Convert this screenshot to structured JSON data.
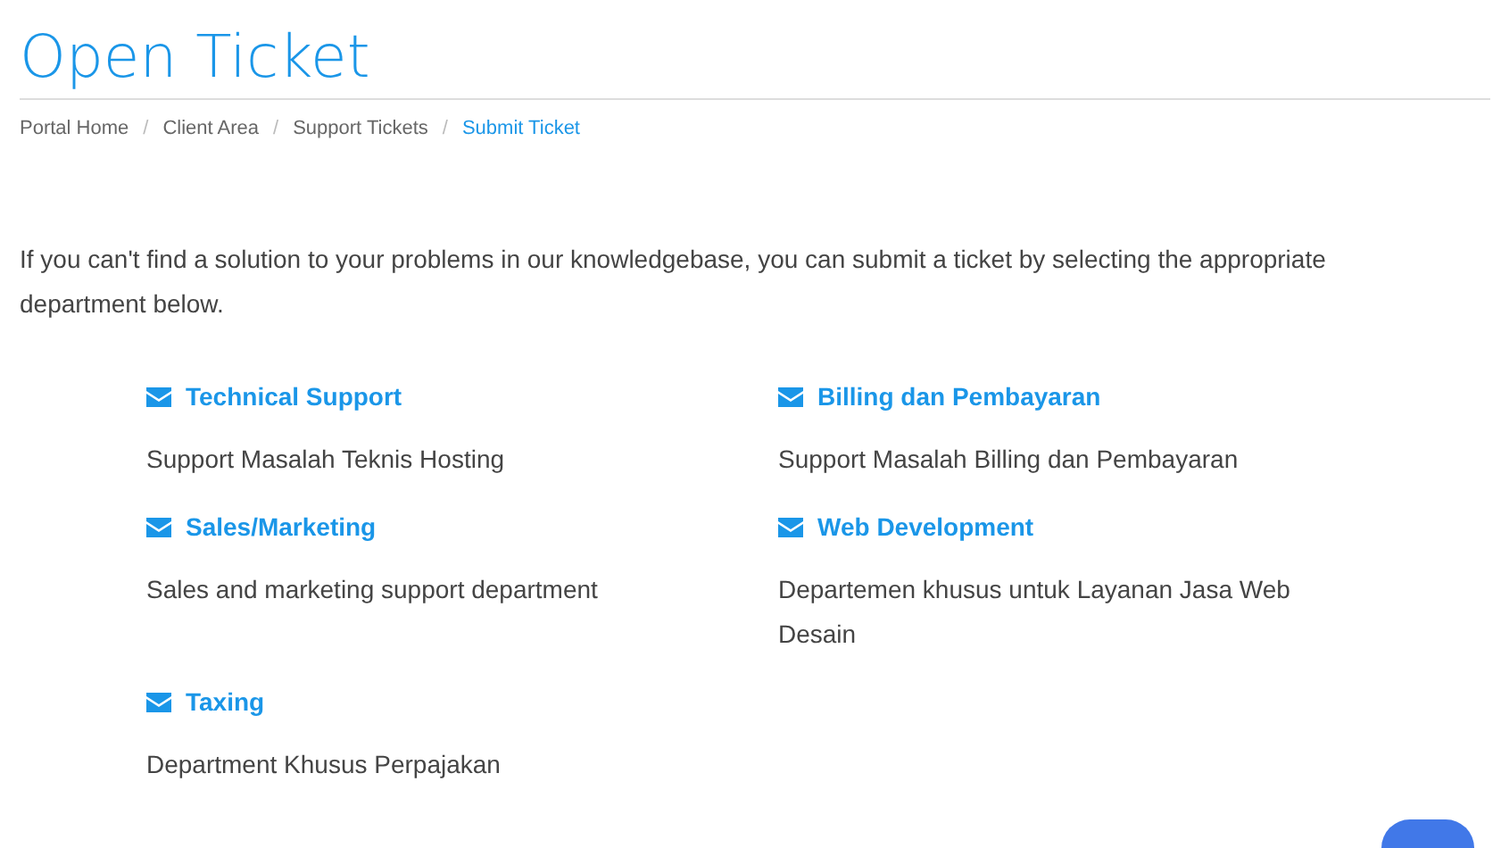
{
  "title": "Open Ticket",
  "breadcrumb": [
    {
      "label": "Portal Home",
      "selected": false
    },
    {
      "label": "Client Area",
      "selected": false
    },
    {
      "label": "Support Tickets",
      "selected": false
    },
    {
      "label": "Submit Ticket",
      "selected": true
    }
  ],
  "breadcrumb_separators": [
    "/",
    "/",
    "/"
  ],
  "intro": "If you can't find a solution to your problems in our knowledgebase, you can submit a ticket by selecting the appropriate department below.",
  "departments": [
    {
      "name": "Technical Support",
      "description": "Support Masalah Teknis Hosting"
    },
    {
      "name": "Billing dan Pembayaran",
      "description": "Support Masalah Billing dan Pembayaran"
    },
    {
      "name": "Sales/Marketing",
      "description": "Sales and marketing support department"
    },
    {
      "name": "Web Development",
      "description": "Departemen khusus untuk Layanan Jasa Web Desain"
    },
    {
      "name": "Taxing",
      "description": "Department Khusus Perpajakan"
    }
  ]
}
